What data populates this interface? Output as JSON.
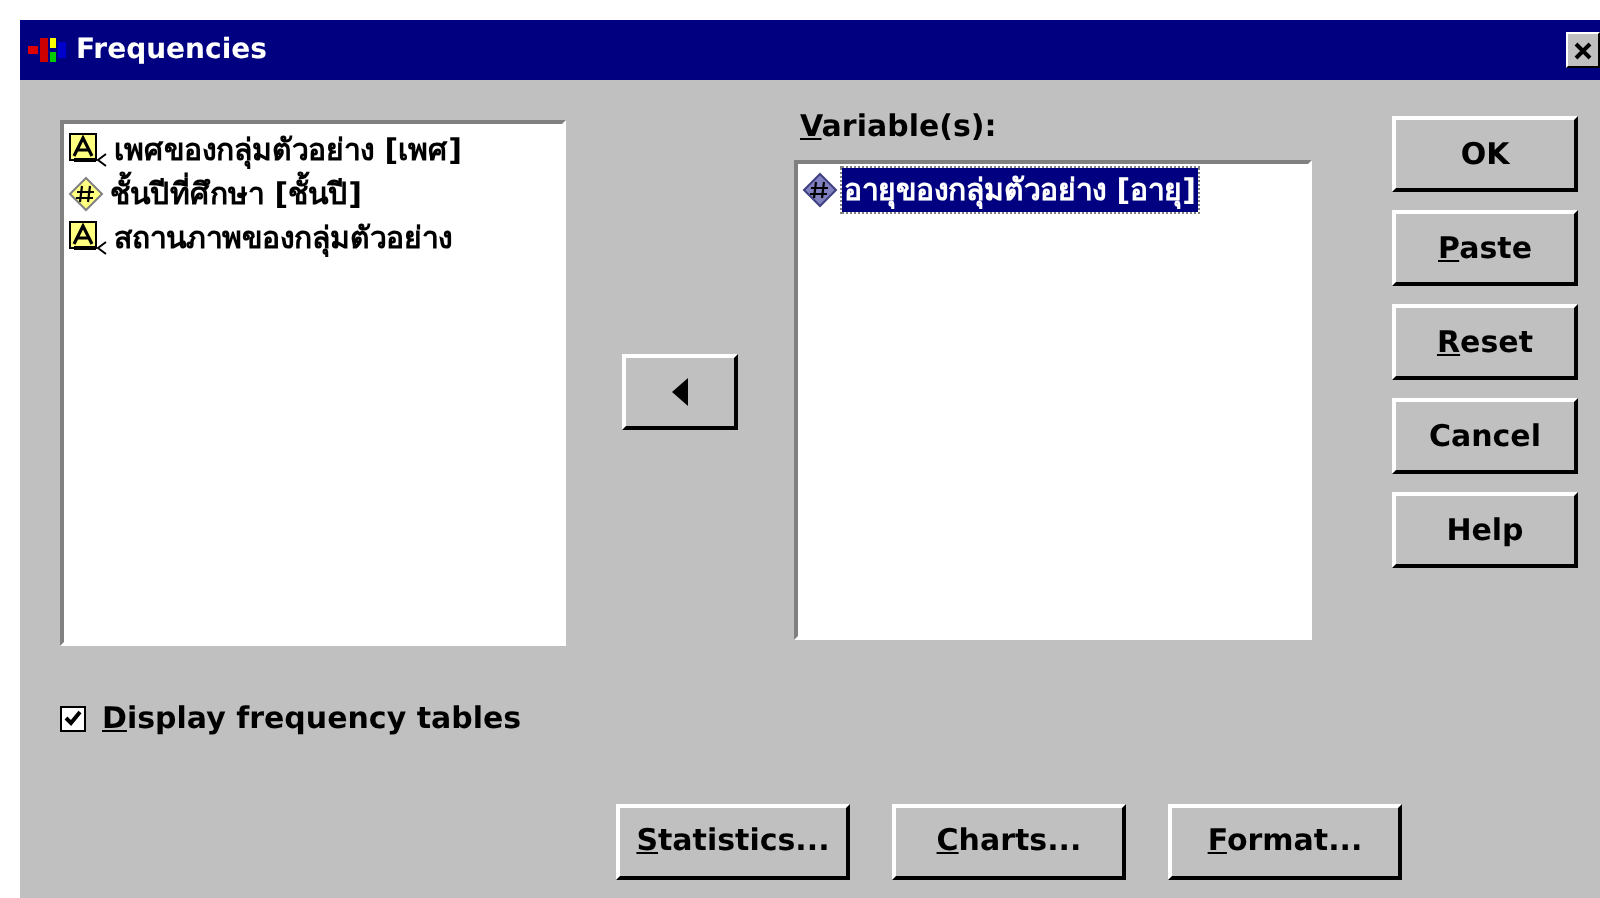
{
  "window": {
    "title": "Frequencies"
  },
  "source_list": {
    "items": [
      {
        "kind": "string",
        "label": "เพศของกลุ่มตัวอย่าง [เพศ]",
        "selected": false
      },
      {
        "kind": "scale",
        "label": "ชั้นปีที่ศึกษา [ชั้นปี]",
        "selected": false
      },
      {
        "kind": "string",
        "label": "สถานภาพของกลุ่มตัวอย่าง",
        "selected": false
      }
    ]
  },
  "variables_label": {
    "text": "Variable(s):",
    "underline_first": true
  },
  "variables_list": {
    "items": [
      {
        "kind": "scale",
        "label": "อายุของกลุ่มตัวอย่าง [อายุ]",
        "selected": true
      }
    ]
  },
  "side_buttons": [
    {
      "label": "OK",
      "underline_first": false
    },
    {
      "label": "Paste",
      "underline_first": true
    },
    {
      "label": "Reset",
      "underline_first": true
    },
    {
      "label": "Cancel",
      "underline_first": false
    },
    {
      "label": "Help",
      "underline_first": false
    }
  ],
  "checkbox": {
    "label": "Display frequency tables",
    "checked": true,
    "underline_first": true
  },
  "bottom_buttons": [
    {
      "label": "Statistics...",
      "underline_first": true
    },
    {
      "label": "Charts...",
      "underline_first": true
    },
    {
      "label": "Format...",
      "underline_first": true
    }
  ]
}
